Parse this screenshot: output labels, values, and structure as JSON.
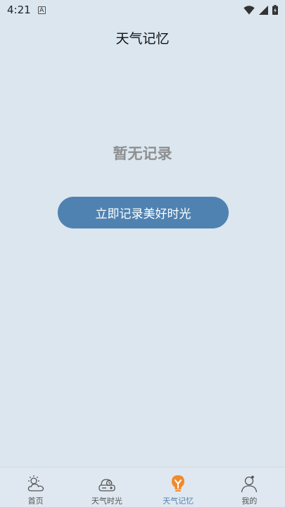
{
  "status_bar": {
    "time": "4:21",
    "notification_icon_letter": "A"
  },
  "header": {
    "title": "天气记忆"
  },
  "main": {
    "empty_message": "暂无记录",
    "record_button_label": "立即记录美好时光"
  },
  "tab_bar": {
    "tabs": [
      {
        "label": "首页",
        "icon": "weather-sun-cloud-icon",
        "active": false
      },
      {
        "label": "天气时光",
        "icon": "cloud-time-icon",
        "active": false
      },
      {
        "label": "天气记忆",
        "icon": "memory-bulb-icon",
        "active": true
      },
      {
        "label": "我的",
        "icon": "user-profile-icon",
        "active": false
      }
    ],
    "active_color": "#4f82b1",
    "active_icon_color": "#f08a2c"
  },
  "colors": {
    "background": "#dbe6ef",
    "button": "#4f82b1",
    "empty_text": "#8d8f91"
  }
}
